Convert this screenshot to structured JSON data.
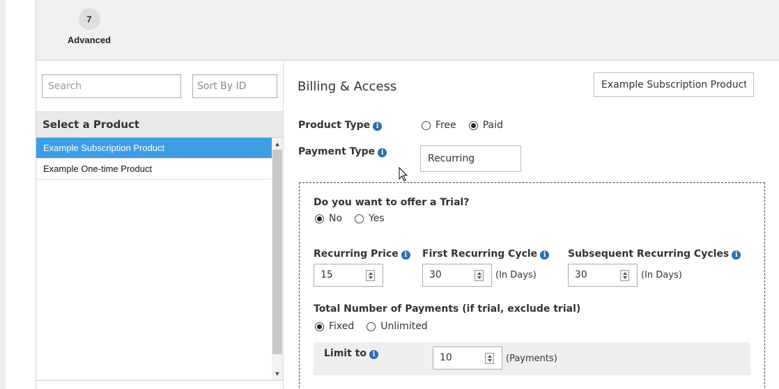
{
  "wizard": {
    "step_number": "7",
    "step_label": "Advanced"
  },
  "products": {
    "search_placeholder": "Search",
    "sort_placeholder": "Sort By ID",
    "list_header": "Select a Product",
    "items": [
      {
        "label": "Example Subscription Product",
        "selected": true
      },
      {
        "label": "Example One-time Product",
        "selected": false
      }
    ]
  },
  "billing": {
    "title": "Billing & Access",
    "product_name": "Example Subscription Product",
    "product_type": {
      "label": "Product Type",
      "options": [
        "Free",
        "Paid"
      ],
      "selected": "Paid"
    },
    "payment_type": {
      "label": "Payment Type",
      "value": "Recurring"
    },
    "trial": {
      "label": "Do you want to offer a Trial?",
      "options": [
        "No",
        "Yes"
      ],
      "selected": "No"
    },
    "recurring_price": {
      "label": "Recurring Price",
      "value": "15"
    },
    "first_cycle": {
      "label": "First Recurring Cycle",
      "value": "30",
      "unit": "(In Days)"
    },
    "subsequent_cycles": {
      "label": "Subsequent Recurring Cycles",
      "value": "30",
      "unit": "(In Days)"
    },
    "total_payments": {
      "label": "Total Number of Payments (if trial, exclude trial)",
      "options": [
        "Fixed",
        "Unlimited"
      ],
      "selected": "Fixed"
    },
    "limit": {
      "label": "Limit to",
      "value": "10",
      "unit": "(Payments)"
    }
  },
  "colors": {
    "selected_item": "#3d9ee5",
    "info_icon": "#2a6cb6"
  }
}
